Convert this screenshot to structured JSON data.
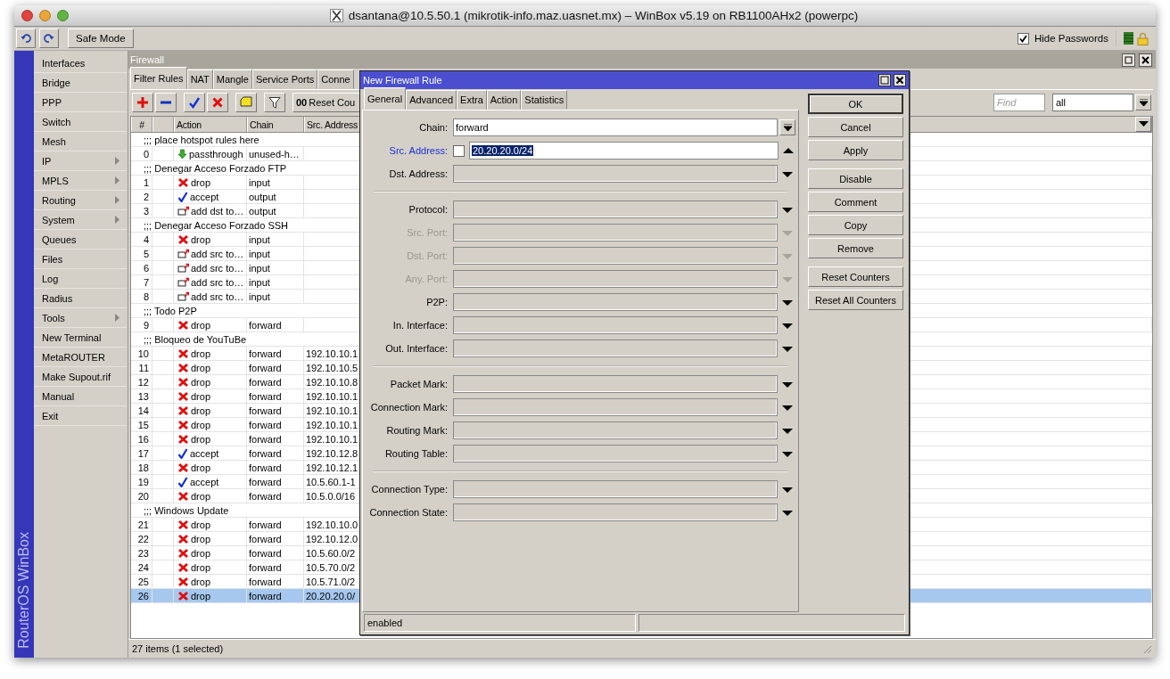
{
  "window": {
    "title": "dsantana@10.5.50.1 (mikrotik-info.maz.uasnet.mx) – WinBox v5.19 on RB1100AHx2 (powerpc)"
  },
  "toolbar": {
    "safe_mode": "Safe Mode",
    "hide_passwords": {
      "label": "Hide Passwords",
      "checked": true
    }
  },
  "side_brand": "RouterOS WinBox",
  "sidebar": {
    "items": [
      {
        "label": "Interfaces",
        "submenu": false
      },
      {
        "label": "Bridge",
        "submenu": false
      },
      {
        "label": "PPP",
        "submenu": false
      },
      {
        "label": "Switch",
        "submenu": false
      },
      {
        "label": "Mesh",
        "submenu": false
      },
      {
        "label": "IP",
        "submenu": true
      },
      {
        "label": "MPLS",
        "submenu": true
      },
      {
        "label": "Routing",
        "submenu": true
      },
      {
        "label": "System",
        "submenu": true
      },
      {
        "label": "Queues",
        "submenu": false
      },
      {
        "label": "Files",
        "submenu": false
      },
      {
        "label": "Log",
        "submenu": false
      },
      {
        "label": "Radius",
        "submenu": false
      },
      {
        "label": "Tools",
        "submenu": true
      },
      {
        "label": "New Terminal",
        "submenu": false
      },
      {
        "label": "MetaROUTER",
        "submenu": false
      },
      {
        "label": "Make Supout.rif",
        "submenu": false
      },
      {
        "label": "Manual",
        "submenu": false
      },
      {
        "label": "Exit",
        "submenu": false
      }
    ]
  },
  "firewall": {
    "title": "Firewall",
    "tabs": [
      {
        "label": "Filter Rules",
        "selected": true
      },
      {
        "label": "NAT",
        "selected": false
      },
      {
        "label": "Mangle",
        "selected": false
      },
      {
        "label": "Service Ports",
        "selected": false
      },
      {
        "label": "Conne",
        "selected": false
      }
    ],
    "toolbar": {
      "reset_prefix": "00",
      "reset_label": "Reset Cou",
      "find_placeholder": "Find",
      "filter_value": "all"
    },
    "table": {
      "columns": [
        {
          "label": "#"
        },
        {
          "label": "Action"
        },
        {
          "label": "Chain"
        },
        {
          "label": "Src. Address"
        }
      ],
      "rows": [
        {
          "kind": "comment",
          "text": ";;; place hotspot rules here",
          "selected": false
        },
        {
          "kind": "passthrough",
          "number": "0",
          "action": "passthrough",
          "chain": "unused-h…",
          "selected": false
        },
        {
          "kind": "comment",
          "text": ";;; Denegar Acceso Forzado FTP",
          "selected": false
        },
        {
          "kind": "drop",
          "number": "1",
          "action": "drop",
          "chain": "input",
          "selected": false
        },
        {
          "kind": "accept",
          "number": "2",
          "action": "accept",
          "chain": "output",
          "selected": false
        },
        {
          "kind": "add",
          "number": "3",
          "action": "add dst to…",
          "chain": "output",
          "selected": false
        },
        {
          "kind": "comment",
          "text": ";;; Denegar Acceso Forzado SSH",
          "selected": false
        },
        {
          "kind": "drop",
          "number": "4",
          "action": "drop",
          "chain": "input",
          "selected": false
        },
        {
          "kind": "add",
          "number": "5",
          "action": "add src to…",
          "chain": "input",
          "selected": false
        },
        {
          "kind": "add",
          "number": "6",
          "action": "add src to…",
          "chain": "input",
          "selected": false
        },
        {
          "kind": "add",
          "number": "7",
          "action": "add src to…",
          "chain": "input",
          "selected": false
        },
        {
          "kind": "add",
          "number": "8",
          "action": "add src to…",
          "chain": "input",
          "selected": false
        },
        {
          "kind": "comment",
          "text": ";;; Todo P2P",
          "selected": false
        },
        {
          "kind": "drop",
          "number": "9",
          "action": "drop",
          "chain": "forward",
          "selected": false
        },
        {
          "kind": "comment",
          "text": ";;; Bloqueo de YouTuBe",
          "selected": false
        },
        {
          "kind": "drop",
          "number": "10",
          "action": "drop",
          "chain": "forward",
          "src": "192.10.10.1",
          "selected": false
        },
        {
          "kind": "drop",
          "number": "11",
          "action": "drop",
          "chain": "forward",
          "src": "192.10.10.5",
          "selected": false
        },
        {
          "kind": "drop",
          "number": "12",
          "action": "drop",
          "chain": "forward",
          "src": "192.10.10.8",
          "selected": false
        },
        {
          "kind": "drop",
          "number": "13",
          "action": "drop",
          "chain": "forward",
          "src": "192.10.10.1",
          "selected": false
        },
        {
          "kind": "drop",
          "number": "14",
          "action": "drop",
          "chain": "forward",
          "src": "192.10.10.1",
          "selected": false
        },
        {
          "kind": "drop",
          "number": "15",
          "action": "drop",
          "chain": "forward",
          "src": "192.10.10.1",
          "selected": false
        },
        {
          "kind": "drop",
          "number": "16",
          "action": "drop",
          "chain": "forward",
          "src": "192.10.10.1",
          "selected": false
        },
        {
          "kind": "accept",
          "number": "17",
          "action": "accept",
          "chain": "forward",
          "src": "192.10.12.8",
          "selected": false
        },
        {
          "kind": "drop",
          "number": "18",
          "action": "drop",
          "chain": "forward",
          "src": "192.10.12.1",
          "selected": false
        },
        {
          "kind": "accept",
          "number": "19",
          "action": "accept",
          "chain": "forward",
          "src": "10.5.60.1-1",
          "selected": false
        },
        {
          "kind": "drop",
          "number": "20",
          "action": "drop",
          "chain": "forward",
          "src": "10.5.0.0/16",
          "selected": false
        },
        {
          "kind": "comment",
          "text": ";;; Windows Update",
          "selected": false
        },
        {
          "kind": "drop",
          "number": "21",
          "action": "drop",
          "chain": "forward",
          "src": "192.10.10.0",
          "selected": false
        },
        {
          "kind": "drop",
          "number": "22",
          "action": "drop",
          "chain": "forward",
          "src": "192.10.12.0",
          "selected": false
        },
        {
          "kind": "drop",
          "number": "23",
          "action": "drop",
          "chain": "forward",
          "src": "10.5.60.0/2",
          "selected": false
        },
        {
          "kind": "drop",
          "number": "24",
          "action": "drop",
          "chain": "forward",
          "src": "10.5.70.0/2",
          "selected": false
        },
        {
          "kind": "drop",
          "number": "25",
          "action": "drop",
          "chain": "forward",
          "src": "10.5.71.0/2",
          "selected": false
        },
        {
          "kind": "drop",
          "number": "26",
          "action": "drop",
          "chain": "forward",
          "src": "20.20.20.0/",
          "selected": true
        }
      ]
    },
    "status": "27 items (1 selected)"
  },
  "dialog": {
    "title": "New Firewall Rule",
    "tabs": [
      {
        "label": "General",
        "selected": true
      },
      {
        "label": "Advanced",
        "selected": false
      },
      {
        "label": "Extra",
        "selected": false
      },
      {
        "label": "Action",
        "selected": false
      },
      {
        "label": "Statistics",
        "selected": false
      }
    ],
    "groups": [
      {
        "fields": [
          {
            "kind": "combo",
            "label": "Chain:",
            "value": "forward"
          },
          {
            "kind": "address",
            "label": "Src. Address:",
            "checked": false,
            "value": "20.20.20.0/24",
            "highlighted": true
          },
          {
            "kind": "list",
            "label": "Dst. Address:",
            "disabled": false
          }
        ]
      },
      {
        "fields": [
          {
            "kind": "list",
            "label": "Protocol:",
            "disabled": false
          },
          {
            "kind": "list",
            "label": "Src. Port:",
            "disabled": true
          },
          {
            "kind": "list",
            "label": "Dst. Port:",
            "disabled": true
          },
          {
            "kind": "list",
            "label": "Any. Port:",
            "disabled": true
          },
          {
            "kind": "list",
            "label": "P2P:",
            "disabled": false
          },
          {
            "kind": "list",
            "label": "In. Interface:",
            "disabled": false
          },
          {
            "kind": "list",
            "label": "Out. Interface:",
            "disabled": false
          }
        ]
      },
      {
        "fields": [
          {
            "kind": "list",
            "label": "Packet Mark:",
            "disabled": false
          },
          {
            "kind": "list",
            "label": "Connection Mark:",
            "disabled": false
          },
          {
            "kind": "list",
            "label": "Routing Mark:",
            "disabled": false
          },
          {
            "kind": "list",
            "label": "Routing Table:",
            "disabled": false
          }
        ]
      },
      {
        "fields": [
          {
            "kind": "list",
            "label": "Connection Type:",
            "disabled": false
          },
          {
            "kind": "list",
            "label": "Connection State:",
            "disabled": false
          }
        ]
      }
    ],
    "button_groups": [
      [
        {
          "label": "OK",
          "default": true
        },
        {
          "label": "Cancel",
          "default": false
        },
        {
          "label": "Apply",
          "default": false
        }
      ],
      [
        {
          "label": "Disable",
          "default": false
        },
        {
          "label": "Comment",
          "default": false
        },
        {
          "label": "Copy",
          "default": false
        },
        {
          "label": "Remove",
          "default": false
        }
      ],
      [
        {
          "label": "Reset Counters",
          "default": false
        },
        {
          "label": "Reset All Counters",
          "default": false
        }
      ]
    ],
    "status": "enabled"
  }
}
